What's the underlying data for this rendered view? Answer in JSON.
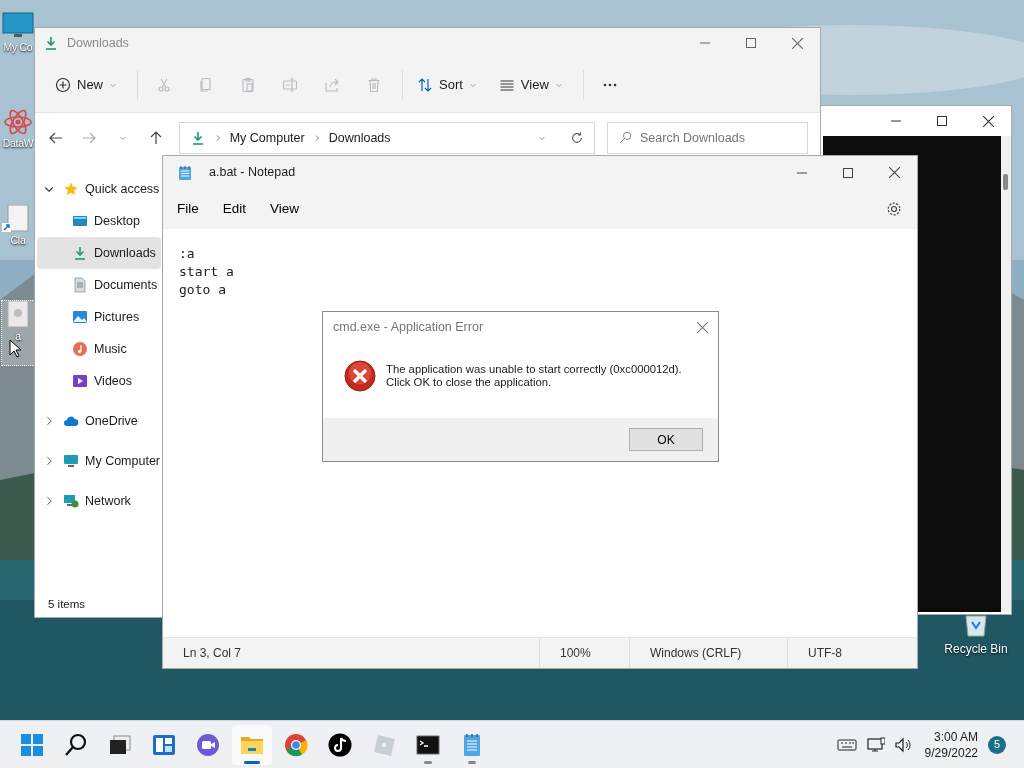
{
  "desktop": {
    "icons": [
      {
        "kind": "computer",
        "label": "My Co",
        "selected": false
      },
      {
        "kind": "atom",
        "label": "DataW",
        "selected": false
      },
      {
        "kind": "document",
        "label": "Cla",
        "selected": false
      },
      {
        "kind": "file",
        "label": "a",
        "selected": true
      }
    ],
    "recycle_bin": {
      "label": "Recycle Bin"
    }
  },
  "explorer": {
    "title": "Downloads",
    "toolbar": [
      {
        "kind": "new",
        "label": "New",
        "disabled": false
      },
      {
        "kind": "cut",
        "disabled": true
      },
      {
        "kind": "copy",
        "disabled": true
      },
      {
        "kind": "paste",
        "disabled": true
      },
      {
        "kind": "rename",
        "disabled": true
      },
      {
        "kind": "share",
        "disabled": true
      },
      {
        "kind": "delete",
        "disabled": true
      },
      {
        "kind": "sort",
        "label": "Sort",
        "disabled": false
      },
      {
        "kind": "view",
        "label": "View",
        "disabled": false
      },
      {
        "kind": "more",
        "disabled": false
      }
    ],
    "address": {
      "path": [
        "My Computer",
        "Downloads"
      ]
    },
    "search": {
      "placeholder": "Search Downloads"
    },
    "sidebar": {
      "items": [
        {
          "kind": "star",
          "label": "Quick access",
          "expanded": true,
          "selected": false,
          "children": [
            {
              "kind": "desktop",
              "label": "Desktop",
              "selected": false
            },
            {
              "kind": "download",
              "label": "Downloads",
              "selected": true
            },
            {
              "kind": "documents",
              "label": "Documents",
              "selected": false
            },
            {
              "kind": "pictures",
              "label": "Pictures",
              "selected": false
            },
            {
              "kind": "music",
              "label": "Music",
              "selected": false
            },
            {
              "kind": "videos",
              "label": "Videos",
              "selected": false
            }
          ]
        },
        {
          "kind": "cloud",
          "label": "OneDrive",
          "expanded": false,
          "selected": false
        },
        {
          "kind": "computer",
          "label": "My Computer",
          "expanded": false,
          "selected": false
        },
        {
          "kind": "network",
          "label": "Network",
          "expanded": false,
          "selected": false
        }
      ]
    },
    "status_bar": "5 items"
  },
  "notepad": {
    "title": "a.bat - Notepad",
    "menu": [
      "File",
      "Edit",
      "View"
    ],
    "lines": [
      ":a",
      "start a",
      "goto a"
    ],
    "status_bar": [
      "Ln 3, Col 7",
      "100%",
      "Windows (CRLF)",
      "UTF-8"
    ]
  },
  "dialog": {
    "title": "cmd.exe - Application Error",
    "message": [
      "The application was unable to start correctly (0xc000012d).",
      "Click OK to close the application."
    ],
    "button": "OK"
  },
  "taskbar": {
    "apps": [
      {
        "kind": "start",
        "running": false,
        "active": false
      },
      {
        "kind": "search",
        "running": false,
        "active": false
      },
      {
        "kind": "taskview",
        "running": false,
        "active": false
      },
      {
        "kind": "widgets",
        "running": false,
        "active": false
      },
      {
        "kind": "chat",
        "running": false,
        "active": false
      },
      {
        "kind": "folder",
        "running": true,
        "active": true
      },
      {
        "kind": "browser",
        "running": false,
        "active": false
      },
      {
        "kind": "note",
        "running": false,
        "active": false
      },
      {
        "kind": "tilted",
        "running": false,
        "active": false
      },
      {
        "kind": "terminal",
        "running": true,
        "active": false
      },
      {
        "kind": "notepad",
        "running": true,
        "active": false
      }
    ],
    "time": "3:00 AM",
    "date": "9/29/2022",
    "notifications": "5"
  }
}
